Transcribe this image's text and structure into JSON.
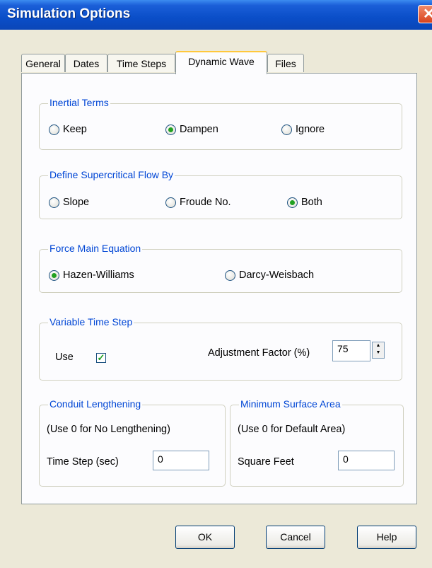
{
  "window": {
    "title": "Simulation Options"
  },
  "tabs": [
    "General",
    "Dates",
    "Time Steps",
    "Dynamic Wave",
    "Files"
  ],
  "inertial_terms": {
    "title": "Inertial Terms",
    "options": [
      "Keep",
      "Dampen",
      "Ignore"
    ],
    "selected": "Dampen"
  },
  "supercritical": {
    "title": "Define Supercritical Flow By",
    "options": [
      "Slope",
      "Froude No.",
      "Both"
    ],
    "selected": "Both"
  },
  "force_main": {
    "title": "Force Main Equation",
    "options": [
      "Hazen-Williams",
      "Darcy-Weisbach"
    ],
    "selected": "Hazen-Williams"
  },
  "variable_time_step": {
    "title": "Variable Time Step",
    "use_label": "Use",
    "use_checked": true,
    "factor_label": "Adjustment Factor (%)",
    "factor_value": "75"
  },
  "conduit_lengthening": {
    "title": "Conduit Lengthening",
    "note": "(Use 0 for No Lengthening)",
    "field_label": "Time Step (sec)",
    "field_value": "0"
  },
  "min_surface_area": {
    "title": "Minimum Surface Area",
    "note": "(Use 0 for Default Area)",
    "field_label": "Square Feet",
    "field_value": "0"
  },
  "buttons": {
    "ok": "OK",
    "cancel": "Cancel",
    "help": "Help"
  },
  "icons": {
    "close": "close-icon",
    "check": "check-icon",
    "spin": "spin-arrows-icon"
  }
}
